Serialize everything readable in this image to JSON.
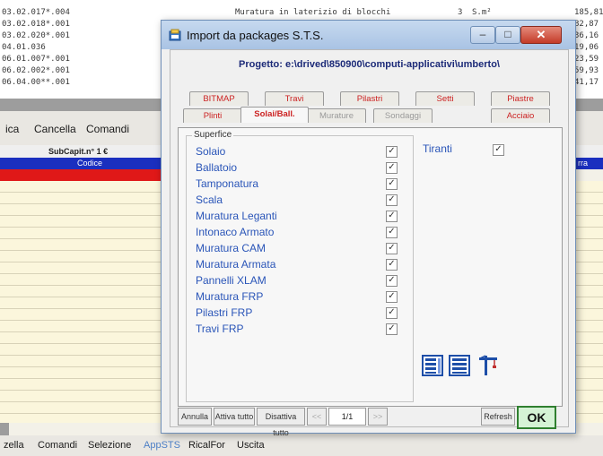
{
  "background": {
    "rows": [
      {
        "code": "03.02.017*.004",
        "desc": "Muratura in laterizio di blocchi",
        "qty": "3",
        "unit": "S.m²",
        "price": "185,81"
      },
      {
        "code": "03.02.018*.001",
        "desc": "",
        "qty": "",
        "unit": "",
        "price": "82,87"
      },
      {
        "code": "03.02.020*.001",
        "desc": "",
        "qty": "",
        "unit": "",
        "price": "36,16"
      },
      {
        "code": "04.01.036",
        "desc": "",
        "qty": "",
        "unit": "",
        "price": "19,06"
      },
      {
        "code": "06.01.007*.001",
        "desc": "",
        "qty": "",
        "unit": "",
        "price": "23,59"
      },
      {
        "code": "06.02.002*.001",
        "desc": "",
        "qty": "",
        "unit": "",
        "price": "59,93"
      },
      {
        "code": "06.04.00**.001",
        "desc": "",
        "qty": "",
        "unit": "",
        "price": "41,17"
      }
    ],
    "menu": [
      "ica",
      "Cancella",
      "Comandi"
    ],
    "subcap_header": "SubCapit.n° 1 €",
    "codice_header": "Codice",
    "right_header": "rra",
    "bottom_menu": [
      "zella",
      "Comandi",
      "Selezione",
      "AppSTS",
      "RicalFor",
      "Uscita"
    ]
  },
  "dialog": {
    "title": "Import da packages S.T.S.",
    "project": "Progetto: e:\\drived\\850900\\computi-applicativi\\umberto\\",
    "tabs_row1": [
      "BITMAP",
      "Travi",
      "Pilastri",
      "Setti",
      "Piastre"
    ],
    "tabs_row2": [
      "Plinti",
      "Solai/Ball.",
      "Murature",
      "Sondaggi",
      "Acciaio"
    ],
    "active_tab": "Solai/Ball.",
    "group_label": "Superfice",
    "items": [
      {
        "label": "Solaio",
        "checked": "✓"
      },
      {
        "label": "Ballatoio",
        "checked": "✓"
      },
      {
        "label": "Tamponatura",
        "checked": "✓"
      },
      {
        "label": "Scala",
        "checked": "✓"
      },
      {
        "label": "Muratura Leganti",
        "checked": "✓"
      },
      {
        "label": "Intonaco Armato",
        "checked": "✓"
      },
      {
        "label": "Muratura CAM",
        "checked": "✓"
      },
      {
        "label": "Muratura Armata",
        "checked": "✓"
      },
      {
        "label": "Pannelli XLAM",
        "checked": "✓"
      },
      {
        "label": "Muratura FRP",
        "checked": "✓"
      },
      {
        "label": "Pilastri FRP",
        "checked": "✓"
      },
      {
        "label": "Travi FRP",
        "checked": "✓"
      }
    ],
    "tiranti": {
      "label": "Tiranti",
      "checked": "✓"
    },
    "buttons": {
      "annulla": "Annulla",
      "attiva": "Attiva tutto",
      "disattiva": "Disattiva tutto",
      "prev": "<<",
      "page": "1/1",
      "next": ">>",
      "refresh": "Refresh",
      "ok": "OK"
    }
  }
}
